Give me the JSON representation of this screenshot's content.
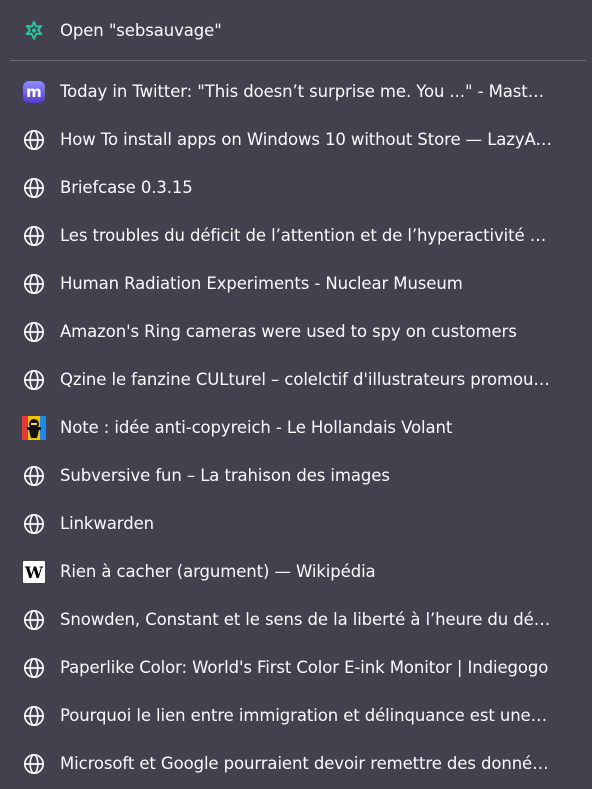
{
  "open_action": {
    "label": "Open \"sebsauvage\"",
    "icon": "extension-puzzle-icon"
  },
  "history": [
    {
      "title": "Today in Twitter: \"This doesn’t surprise me. You ...\" - Mastod...",
      "icon": "mastodon-icon"
    },
    {
      "title": "How To install apps on Windows 10 without Store — LazyAd...",
      "icon": "globe-icon"
    },
    {
      "title": "Briefcase 0.3.15",
      "icon": "globe-icon"
    },
    {
      "title": "Les troubles du déficit de l’attention et de l’hyperactivité (TD...",
      "icon": "globe-icon"
    },
    {
      "title": "Human Radiation Experiments - Nuclear Museum",
      "icon": "globe-icon"
    },
    {
      "title": "Amazon's Ring cameras were used to spy on customers",
      "icon": "globe-icon"
    },
    {
      "title": "Qzine le fanzine CULturel – colelctif d'illustrateurs promouva...",
      "icon": "globe-icon"
    },
    {
      "title": "Note : idée anti-copyreich - Le Hollandais Volant",
      "icon": "hollandais-volant-icon"
    },
    {
      "title": "Subversive fun – La trahison des images",
      "icon": "globe-icon"
    },
    {
      "title": "Linkwarden",
      "icon": "globe-icon"
    },
    {
      "title": "Rien à cacher (argument) — Wikipédia",
      "icon": "wikipedia-icon"
    },
    {
      "title": "Snowden, Constant et le sens de la liberté à l’heure du désa...",
      "icon": "globe-icon"
    },
    {
      "title": "Paperlike Color: World's First Color E-ink Monitor | Indiegogo",
      "icon": "globe-icon"
    },
    {
      "title": "Pourquoi le lien entre immigration et délinquance est une ill...",
      "icon": "globe-icon"
    },
    {
      "title": "Microsoft et Google pourraient devoir remettre des donnée...",
      "icon": "globe-icon"
    }
  ],
  "colors": {
    "background": "#42414d",
    "text": "#fbfbfe",
    "separator": "#6b6a75",
    "extension_icon": "#2ac3a2"
  }
}
